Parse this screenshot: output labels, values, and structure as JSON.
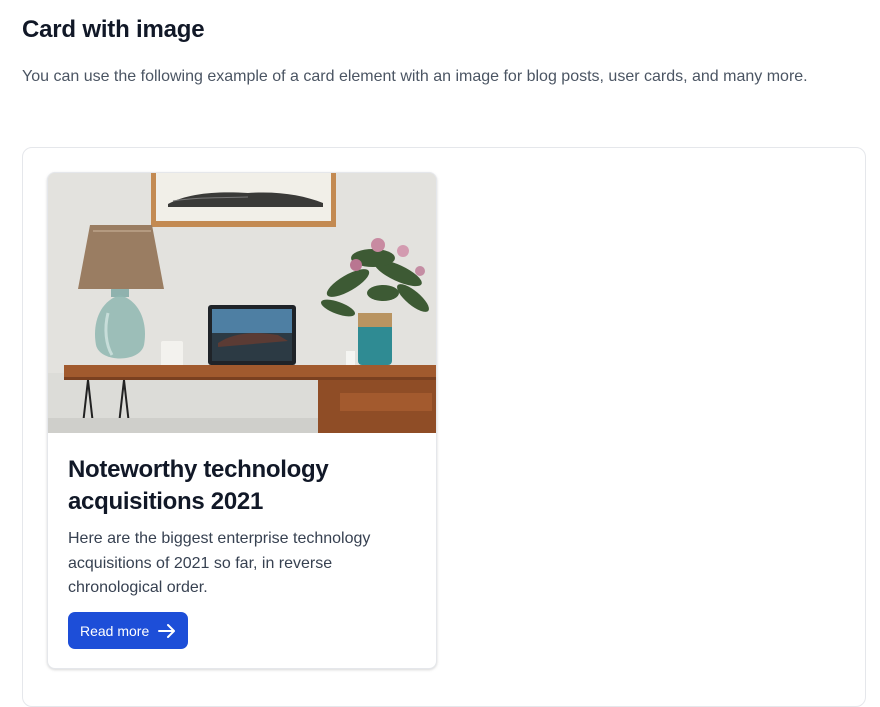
{
  "section": {
    "title": "Card with image",
    "description": "You can use the following example of a card element with an image for blog posts, user cards, and many more."
  },
  "card": {
    "image_alt": "desk-with-laptop-lamp-and-flowers-photo",
    "title": "Noteworthy technology acquisitions 2021",
    "text": "Here are the biggest enterprise technology acquisitions of 2021 so far, in reverse chronological order.",
    "button_label": "Read more",
    "button_icon": "arrow-right-icon"
  },
  "colors": {
    "button_bg": "#1d4ed8",
    "heading": "#111827",
    "body_text": "#374151",
    "border": "#e5e7eb"
  }
}
